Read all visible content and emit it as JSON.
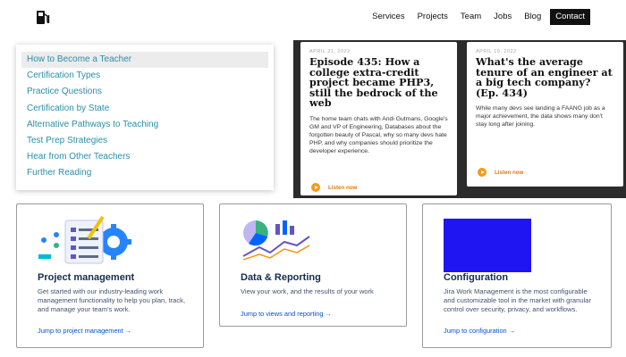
{
  "header": {
    "logo_icon": "fuel-pump-icon",
    "nav": [
      "Services",
      "Projects",
      "Team",
      "Jobs",
      "Blog"
    ],
    "contact": "Contact"
  },
  "menu": {
    "items": [
      "How to Become a Teacher",
      "Certification Types",
      "Practice Questions",
      "Certification by State",
      "Alternative Pathways to Teaching",
      "Test Prep Strategies",
      "Hear from Other Teachers",
      "Further Reading"
    ],
    "active_index": 0,
    "color": "#2a8fa6"
  },
  "podcasts": [
    {
      "date": "APRIL 21, 2022",
      "title": "Episode 435: How a college extra-credit project became PHP3, still the bedrock of the web",
      "desc": "The home team chats with Andi Gutmans, Google's GM and VP of Engineering, Databases about the forgotten beauty of Pascal, why so many devs hate PHP, and why companies should prioritize the developer experience.",
      "listen": "Listen now"
    },
    {
      "date": "APRIL 19, 2022",
      "title": "What's the average tenure of an engineer at a big tech company? (Ep. 434)",
      "desc": "While many devs see landing a FAANG job as a major achievement, the data shows many don't stay long after joining.",
      "listen": "Listen now"
    }
  ],
  "features": [
    {
      "title": "Project management",
      "desc": "Get started with our industry-leading work management functionality to help you plan, track, and manage your team's work.",
      "link": "Jump to project management →",
      "icon": "project-management-illustration"
    },
    {
      "title": "Data & Reporting",
      "desc": "View your work, and the results of your work",
      "link": "Jump to views and reporting →",
      "icon": "data-reporting-illustration"
    },
    {
      "title": "Configuration",
      "desc": "Jira Work Management is the most configurable and customizable tool in the market with granular control over security, privacy, and workflows.",
      "link": "Jump to configuration →",
      "icon": "configuration-illustration"
    }
  ],
  "colors": {
    "accent_link": "#0052cc",
    "listen_orange": "#f29b18",
    "podcast_bg": "#2b2b2b",
    "config_blue": "#1f14f2"
  }
}
